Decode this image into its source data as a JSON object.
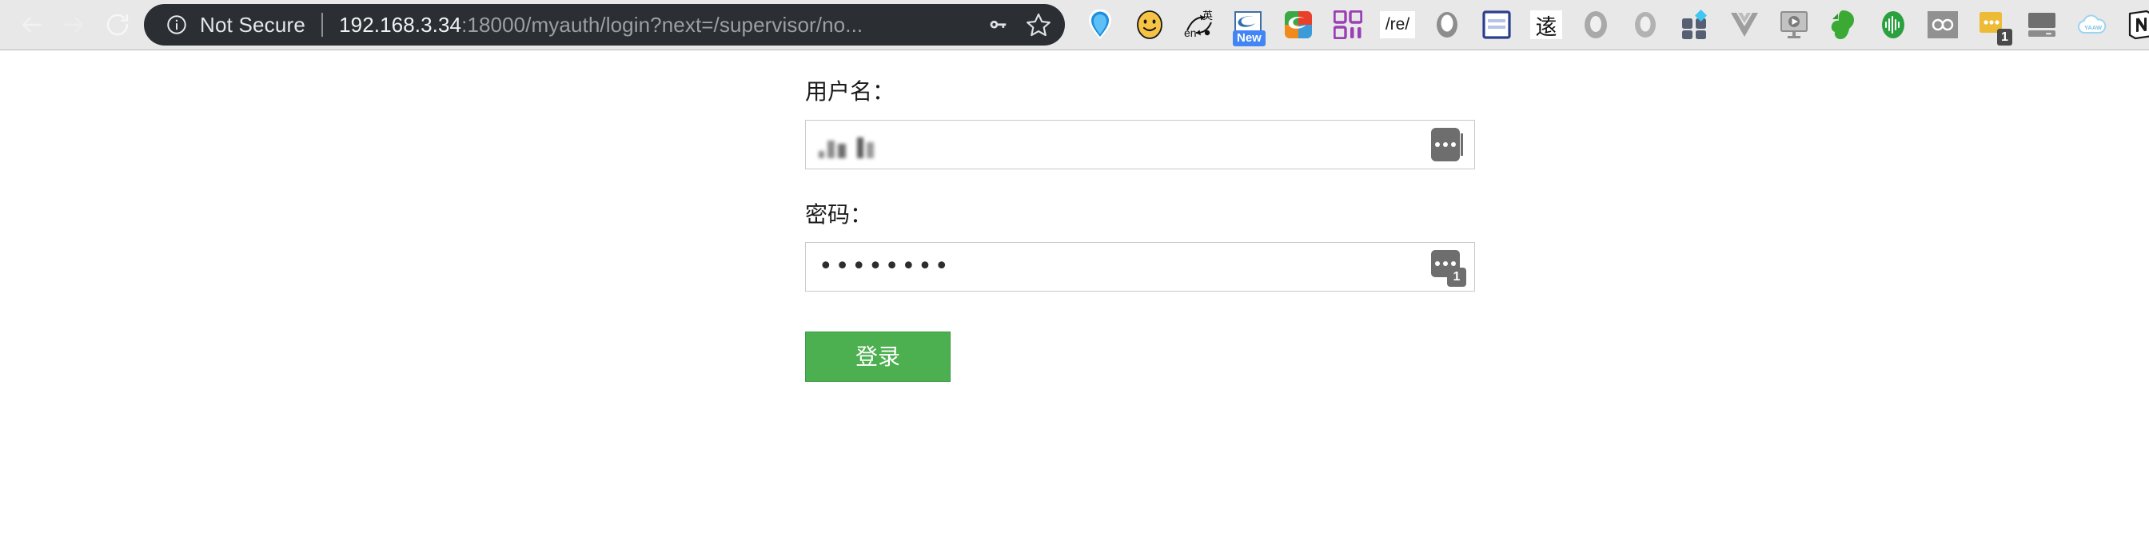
{
  "browser": {
    "nav": {
      "back_label": "Back",
      "forward_label": "Forward",
      "reload_label": "Reload"
    },
    "omnibox": {
      "security_icon": "info-circle-icon",
      "security_text": "Not Secure",
      "url_host": "192.168.3.34",
      "url_rest": ":18000/myauth/login?next=/supervisor/no...",
      "key_icon": "key-icon",
      "bookmark_icon": "star-icon"
    },
    "extensions": [
      {
        "name": "youdao-dictionary",
        "icon": "blue-teardrop-icon"
      },
      {
        "name": "smiley-extension",
        "icon": "smiley-face-icon"
      },
      {
        "name": "translate-en-cn",
        "icon": "translate-arrows-icon",
        "glyph": "英"
      },
      {
        "name": "sogou-input",
        "icon": "sogou-s-icon",
        "badge": "New"
      },
      {
        "name": "sogou-pinyin",
        "icon": "sogou-colored-s-icon"
      },
      {
        "name": "grid-launcher",
        "icon": "purple-grid-icon"
      },
      {
        "name": "regex-tool",
        "icon": "regex-icon",
        "glyph": "/re/"
      },
      {
        "name": "oval-extension-gray",
        "icon": "gray-oval-icon"
      },
      {
        "name": "reader-view",
        "icon": "blue-document-icon"
      },
      {
        "name": "chinese-calligraphy",
        "icon": "cjk-glyph-icon",
        "glyph": "逺"
      },
      {
        "name": "oval-extension-gray-2",
        "icon": "gray-ring-icon"
      },
      {
        "name": "oval-extension-gray-3",
        "icon": "gray-ring-icon"
      },
      {
        "name": "app-grid-blue-diamond",
        "icon": "grid-diamond-icon"
      },
      {
        "name": "vue-devtools",
        "icon": "vue-logo-icon"
      },
      {
        "name": "screencast",
        "icon": "monitor-play-icon"
      },
      {
        "name": "evernote-clipper",
        "icon": "evernote-elephant-icon"
      },
      {
        "name": "audio-recorder",
        "icon": "green-waveform-icon"
      },
      {
        "name": "infinity-extension",
        "icon": "infinity-icon"
      },
      {
        "name": "lastpass",
        "icon": "lastpass-icon",
        "badge_count": "1"
      },
      {
        "name": "remote-desktop",
        "icon": "monitor-icon"
      },
      {
        "name": "yaaw-downloader",
        "icon": "cloud-icon",
        "glyph": "YAAW"
      },
      {
        "name": "notion-web-clipper",
        "icon": "notion-logo-icon"
      }
    ]
  },
  "login": {
    "username_label": "用户名：",
    "username_value": "",
    "username_placeholder": "",
    "password_label": "密码：",
    "password_value": "••••••••",
    "submit_label": "登录",
    "lastpass_fill_icon": "lastpass-fill-icon",
    "lastpass_badge_count": "1",
    "accent_color": "#4caf50"
  }
}
